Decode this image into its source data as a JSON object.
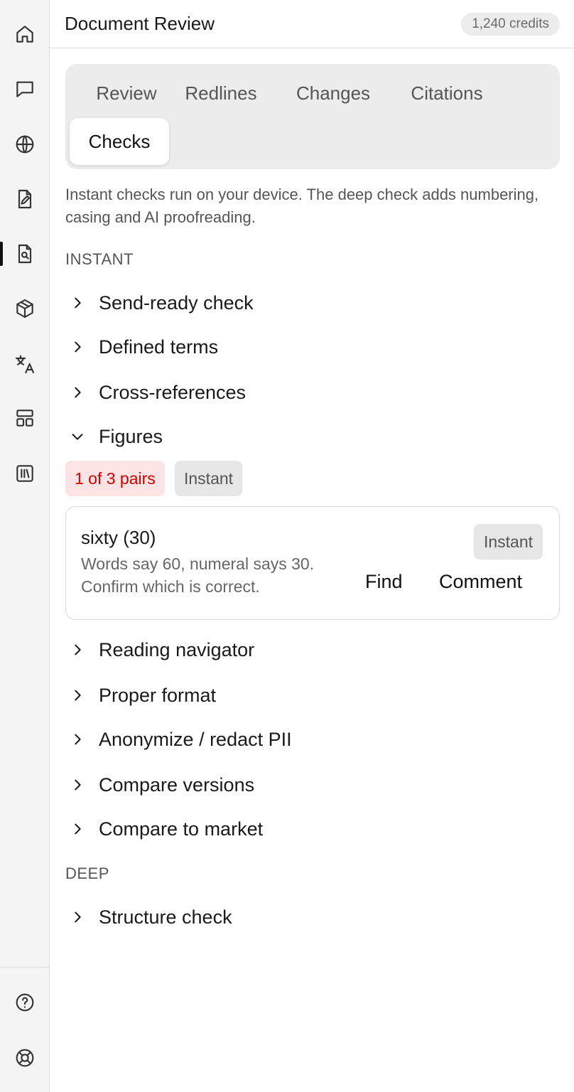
{
  "header": {
    "title": "Document Review",
    "credits": "1,240 credits"
  },
  "rail": {
    "items": [
      {
        "icon": "home-icon"
      },
      {
        "icon": "chat-icon"
      },
      {
        "icon": "globe-icon"
      },
      {
        "icon": "document-edit-icon"
      },
      {
        "icon": "document-search-icon",
        "active": true
      },
      {
        "icon": "package-icon"
      },
      {
        "icon": "translate-icon"
      },
      {
        "icon": "layout-icon"
      },
      {
        "icon": "library-icon"
      }
    ],
    "bottom": [
      {
        "icon": "help-icon"
      },
      {
        "icon": "lifebuoy-icon"
      }
    ]
  },
  "tabs": [
    {
      "label": "Review"
    },
    {
      "label": "Redlines"
    },
    {
      "label": "Changes"
    },
    {
      "label": "Citations"
    },
    {
      "label": "Checks",
      "active": true
    }
  ],
  "intro": "Instant checks run on your device. The deep check adds numbering, casing and AI proofreading.",
  "sections": {
    "instant": {
      "label": "INSTANT",
      "items": [
        {
          "label": "Send-ready check",
          "expanded": false
        },
        {
          "label": "Defined terms",
          "expanded": false
        },
        {
          "label": "Cross-references",
          "expanded": false
        },
        {
          "label": "Figures",
          "expanded": true
        },
        {
          "label": "Reading navigator",
          "expanded": false
        },
        {
          "label": "Proper format",
          "expanded": false
        },
        {
          "label": "Anonymize / redact PII",
          "expanded": false
        },
        {
          "label": "Compare versions",
          "expanded": false
        },
        {
          "label": "Compare to market",
          "expanded": false
        }
      ]
    },
    "deep": {
      "label": "DEEP",
      "items": [
        {
          "label": "Structure check",
          "expanded": false
        }
      ]
    }
  },
  "figures": {
    "count_badge": "1 of 3 pairs",
    "type_badge": "Instant",
    "issue": {
      "title": "sixty (30)",
      "desc_line1": "Words say 60, numeral says 30.",
      "desc_line2": "Confirm which is correct.",
      "badge": "Instant",
      "find_label": "Find",
      "comment_label": "Comment"
    }
  },
  "colors": {
    "alert_red": "#d40000",
    "alert_bg": "#fde3e3",
    "accent": "#111111"
  }
}
